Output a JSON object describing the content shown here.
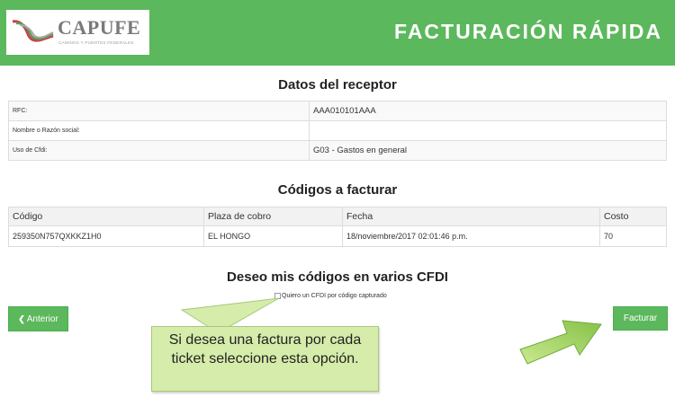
{
  "header": {
    "logo_text": "CAPUFE",
    "logo_subtext": "CAMINOS Y PUENTES FEDERALES",
    "title": "FACTURACIÓN RÁPIDA",
    "brand_color": "#5cb85c"
  },
  "receptor": {
    "title": "Datos del receptor",
    "rows": [
      {
        "label": "RFC:",
        "value": "AAA010101AAA"
      },
      {
        "label": "Nombre o Razón social:",
        "value": ""
      },
      {
        "label": "Uso de Cfdi:",
        "value": "G03 - Gastos en general"
      }
    ]
  },
  "codigos": {
    "title": "Códigos a facturar",
    "headers": [
      "Código",
      "Plaza de cobro",
      "Fecha",
      "Costo"
    ],
    "rows": [
      [
        "259350N757QXKKZ1H0",
        "EL HONGO",
        "18/noviembre/2017 02:01:46 p.m.",
        "70"
      ]
    ]
  },
  "cfdi": {
    "title": "Deseo mis códigos en varios CFDI",
    "checkbox_label": "Quiero un CFDI por código capturado",
    "checked": false
  },
  "buttons": {
    "prev_icon": "chevron-left-icon",
    "prev": "Anterior",
    "next": "Facturar"
  },
  "callout": {
    "text": "Si desea una factura por cada ticket seleccione esta opción.",
    "color": "#d6ecaa"
  },
  "arrow_icon": "pointing-arrow-icon"
}
